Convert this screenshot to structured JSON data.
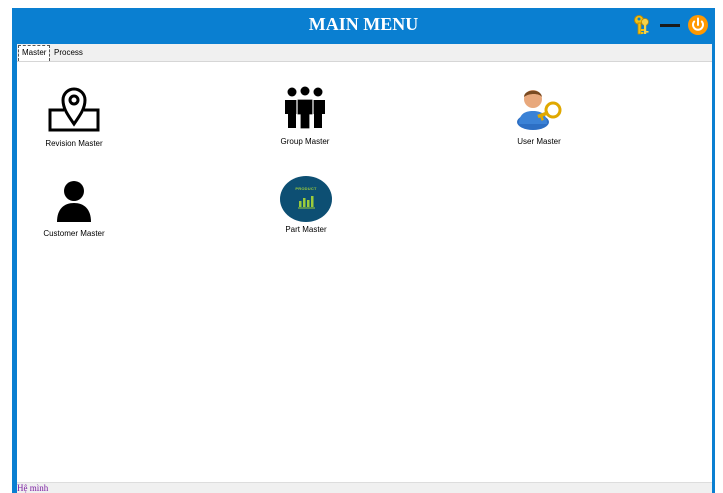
{
  "window": {
    "title": "MAIN MENU"
  },
  "colors": {
    "titlebar": "#0a7fd1",
    "power": "#ff9800",
    "key": "#f4c20d",
    "part_circle": "#0d4f73",
    "status_text": "#7b1fa2"
  },
  "icons": {
    "keys": "keys-icon",
    "minimize": "minimize-icon",
    "power": "power-icon"
  },
  "tabs": [
    {
      "label": "Master",
      "active": true
    },
    {
      "label": "Process",
      "active": false
    }
  ],
  "tiles": {
    "revision": {
      "label": "Revision Master",
      "icon": "location-pin-icon"
    },
    "group": {
      "label": "Group Master",
      "icon": "group-people-icon"
    },
    "user": {
      "label": "User Master",
      "icon": "user-key-icon"
    },
    "customer": {
      "label": "Customer Master",
      "icon": "person-icon"
    },
    "part": {
      "label": "Part Master",
      "icon": "product-icon",
      "badge": "PRODUCT"
    }
  },
  "status": {
    "text": "Hệ mình"
  }
}
